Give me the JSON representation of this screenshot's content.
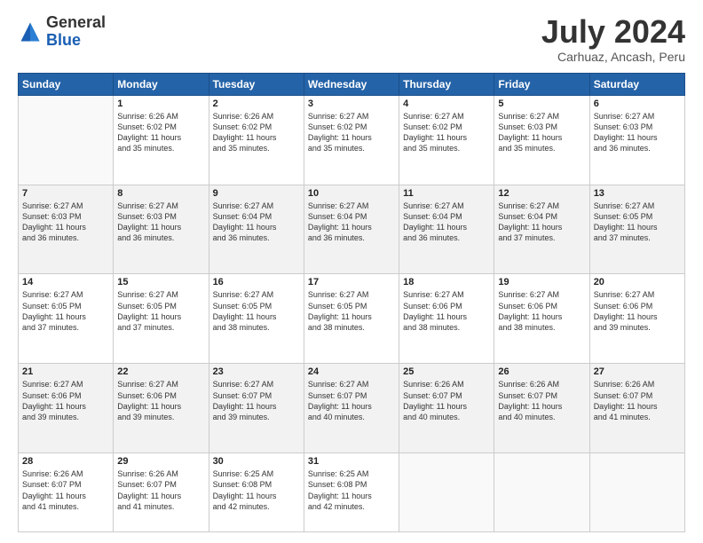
{
  "header": {
    "logo_general": "General",
    "logo_blue": "Blue",
    "month_title": "July 2024",
    "location": "Carhuaz, Ancash, Peru"
  },
  "days_of_week": [
    "Sunday",
    "Monday",
    "Tuesday",
    "Wednesday",
    "Thursday",
    "Friday",
    "Saturday"
  ],
  "weeks": [
    [
      {
        "day": "",
        "sunrise": "",
        "sunset": "",
        "daylight": ""
      },
      {
        "day": "1",
        "sunrise": "Sunrise: 6:26 AM",
        "sunset": "Sunset: 6:02 PM",
        "daylight": "Daylight: 11 hours and 35 minutes."
      },
      {
        "day": "2",
        "sunrise": "Sunrise: 6:26 AM",
        "sunset": "Sunset: 6:02 PM",
        "daylight": "Daylight: 11 hours and 35 minutes."
      },
      {
        "day": "3",
        "sunrise": "Sunrise: 6:27 AM",
        "sunset": "Sunset: 6:02 PM",
        "daylight": "Daylight: 11 hours and 35 minutes."
      },
      {
        "day": "4",
        "sunrise": "Sunrise: 6:27 AM",
        "sunset": "Sunset: 6:02 PM",
        "daylight": "Daylight: 11 hours and 35 minutes."
      },
      {
        "day": "5",
        "sunrise": "Sunrise: 6:27 AM",
        "sunset": "Sunset: 6:03 PM",
        "daylight": "Daylight: 11 hours and 35 minutes."
      },
      {
        "day": "6",
        "sunrise": "Sunrise: 6:27 AM",
        "sunset": "Sunset: 6:03 PM",
        "daylight": "Daylight: 11 hours and 36 minutes."
      }
    ],
    [
      {
        "day": "7",
        "sunrise": "Sunrise: 6:27 AM",
        "sunset": "Sunset: 6:03 PM",
        "daylight": "Daylight: 11 hours and 36 minutes."
      },
      {
        "day": "8",
        "sunrise": "Sunrise: 6:27 AM",
        "sunset": "Sunset: 6:03 PM",
        "daylight": "Daylight: 11 hours and 36 minutes."
      },
      {
        "day": "9",
        "sunrise": "Sunrise: 6:27 AM",
        "sunset": "Sunset: 6:04 PM",
        "daylight": "Daylight: 11 hours and 36 minutes."
      },
      {
        "day": "10",
        "sunrise": "Sunrise: 6:27 AM",
        "sunset": "Sunset: 6:04 PM",
        "daylight": "Daylight: 11 hours and 36 minutes."
      },
      {
        "day": "11",
        "sunrise": "Sunrise: 6:27 AM",
        "sunset": "Sunset: 6:04 PM",
        "daylight": "Daylight: 11 hours and 36 minutes."
      },
      {
        "day": "12",
        "sunrise": "Sunrise: 6:27 AM",
        "sunset": "Sunset: 6:04 PM",
        "daylight": "Daylight: 11 hours and 37 minutes."
      },
      {
        "day": "13",
        "sunrise": "Sunrise: 6:27 AM",
        "sunset": "Sunset: 6:05 PM",
        "daylight": "Daylight: 11 hours and 37 minutes."
      }
    ],
    [
      {
        "day": "14",
        "sunrise": "Sunrise: 6:27 AM",
        "sunset": "Sunset: 6:05 PM",
        "daylight": "Daylight: 11 hours and 37 minutes."
      },
      {
        "day": "15",
        "sunrise": "Sunrise: 6:27 AM",
        "sunset": "Sunset: 6:05 PM",
        "daylight": "Daylight: 11 hours and 37 minutes."
      },
      {
        "day": "16",
        "sunrise": "Sunrise: 6:27 AM",
        "sunset": "Sunset: 6:05 PM",
        "daylight": "Daylight: 11 hours and 38 minutes."
      },
      {
        "day": "17",
        "sunrise": "Sunrise: 6:27 AM",
        "sunset": "Sunset: 6:05 PM",
        "daylight": "Daylight: 11 hours and 38 minutes."
      },
      {
        "day": "18",
        "sunrise": "Sunrise: 6:27 AM",
        "sunset": "Sunset: 6:06 PM",
        "daylight": "Daylight: 11 hours and 38 minutes."
      },
      {
        "day": "19",
        "sunrise": "Sunrise: 6:27 AM",
        "sunset": "Sunset: 6:06 PM",
        "daylight": "Daylight: 11 hours and 38 minutes."
      },
      {
        "day": "20",
        "sunrise": "Sunrise: 6:27 AM",
        "sunset": "Sunset: 6:06 PM",
        "daylight": "Daylight: 11 hours and 39 minutes."
      }
    ],
    [
      {
        "day": "21",
        "sunrise": "Sunrise: 6:27 AM",
        "sunset": "Sunset: 6:06 PM",
        "daylight": "Daylight: 11 hours and 39 minutes."
      },
      {
        "day": "22",
        "sunrise": "Sunrise: 6:27 AM",
        "sunset": "Sunset: 6:06 PM",
        "daylight": "Daylight: 11 hours and 39 minutes."
      },
      {
        "day": "23",
        "sunrise": "Sunrise: 6:27 AM",
        "sunset": "Sunset: 6:07 PM",
        "daylight": "Daylight: 11 hours and 39 minutes."
      },
      {
        "day": "24",
        "sunrise": "Sunrise: 6:27 AM",
        "sunset": "Sunset: 6:07 PM",
        "daylight": "Daylight: 11 hours and 40 minutes."
      },
      {
        "day": "25",
        "sunrise": "Sunrise: 6:26 AM",
        "sunset": "Sunset: 6:07 PM",
        "daylight": "Daylight: 11 hours and 40 minutes."
      },
      {
        "day": "26",
        "sunrise": "Sunrise: 6:26 AM",
        "sunset": "Sunset: 6:07 PM",
        "daylight": "Daylight: 11 hours and 40 minutes."
      },
      {
        "day": "27",
        "sunrise": "Sunrise: 6:26 AM",
        "sunset": "Sunset: 6:07 PM",
        "daylight": "Daylight: 11 hours and 41 minutes."
      }
    ],
    [
      {
        "day": "28",
        "sunrise": "Sunrise: 6:26 AM",
        "sunset": "Sunset: 6:07 PM",
        "daylight": "Daylight: 11 hours and 41 minutes."
      },
      {
        "day": "29",
        "sunrise": "Sunrise: 6:26 AM",
        "sunset": "Sunset: 6:07 PM",
        "daylight": "Daylight: 11 hours and 41 minutes."
      },
      {
        "day": "30",
        "sunrise": "Sunrise: 6:25 AM",
        "sunset": "Sunset: 6:08 PM",
        "daylight": "Daylight: 11 hours and 42 minutes."
      },
      {
        "day": "31",
        "sunrise": "Sunrise: 6:25 AM",
        "sunset": "Sunset: 6:08 PM",
        "daylight": "Daylight: 11 hours and 42 minutes."
      },
      {
        "day": "",
        "sunrise": "",
        "sunset": "",
        "daylight": ""
      },
      {
        "day": "",
        "sunrise": "",
        "sunset": "",
        "daylight": ""
      },
      {
        "day": "",
        "sunrise": "",
        "sunset": "",
        "daylight": ""
      }
    ]
  ]
}
